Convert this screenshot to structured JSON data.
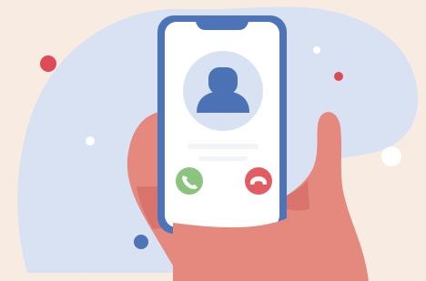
{
  "illustration": {
    "subject": "incoming-call",
    "colors": {
      "background": "#f8ebe2",
      "blob": "#d8e2f3",
      "phone_frame": "#4d73b8",
      "phone_screen": "#ffffff",
      "avatar_circle": "#d8e2f3",
      "avatar_figure": "#4c72b6",
      "accept_button": "#8cc47f",
      "decline_button": "#e45c63",
      "hand": "#e5897e",
      "hand_shadow": "#d8746b",
      "dot_red": "#dd4b57",
      "dot_blue": "#4d73b8",
      "dot_white": "#ffffff"
    },
    "icons": {
      "avatar": "person-icon",
      "accept": "phone-accept-icon",
      "decline": "phone-decline-icon"
    }
  }
}
